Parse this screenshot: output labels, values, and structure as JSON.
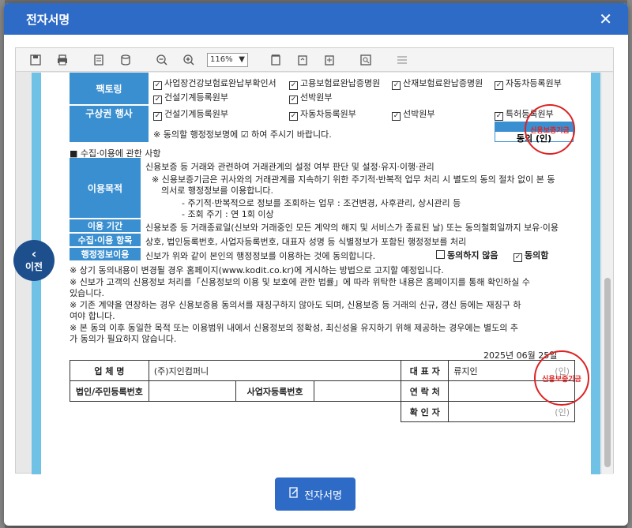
{
  "modal": {
    "title": "전자서명",
    "close_label": "✕"
  },
  "toolbar": {
    "zoom": "116%"
  },
  "form": {
    "factoring_label": "팩토링",
    "factoring_items": [
      "사업장건강보험료완납부확인서",
      "고용보험료완납증명원",
      "산재보험료완납증명원",
      "자동차등록원부",
      "건설기계등록원부",
      "선박원부"
    ],
    "recourse_label": "구상권 행사",
    "recourse_items": [
      "건설기계등록원부",
      "자동차등록원부",
      "선박원부",
      "특허등록원부"
    ],
    "consent_note": "※ 동의할 행정정보명에 ☑ 하여 주시기 바랍니다.",
    "consent_sign": "동의 (인)",
    "collection_header": "■ 수집·이용에 관한 사항",
    "purpose_label": "이용목적",
    "purpose_lines": [
      "신용보증 등 거래와 관련하여 거래관계의 설정 여부 판단 및 설정·유지·이행·관리",
      "※ 신용보증기금은 귀사와의 거래관계를 지속하기 위한 주기적·반복적 업무 처리 시 별도의 동의 절차 없이 본 동",
      "의서로 행정정보를 이용합니다.",
      "- 주기적·반복적으로 정보를 조회하는 업무 : 조건변경, 사후관리, 상시관리 등",
      "- 조회 주기 : 연 1회 이상"
    ],
    "period_label": "이용 기간",
    "period_text": "신용보증 등 거래종료일(신보와 거래중인 모든 계약의 해지 및 서비스가 종료된 날) 또는 동의철회일까지 보유·이용",
    "items_label": "수집·이용 항목",
    "items_text": "상호, 법인등록번호, 사업자등록번호, 대표자 성명 등 식별정보가 포함된 행정정보를 처리",
    "admin_label": "행정정보이용",
    "admin_text": "신보가 위와 같이 본인의 행정정보를 이용하는 것에 동의합니다.",
    "disagree_label": "동의하지 않음",
    "agree_label": "동의함",
    "notes": [
      "※ 상기 동의내용이 변경될 경우 홈페이지(www.kodit.co.kr)에 게시하는 방법으로 고지할 예정입니다.",
      "※ 신보가 고객의 신용정보 처리를「신용정보의 이용 및 보호에 관한 법률」에 따라 위탁한 내용은 홈페이지를 통해 확인하실 수",
      "   있습니다.",
      "※ 기존 계약을 연장하는 경우 신용보증용 동의서를 재징구하지 않아도 되며, 신용보증 등 거래의 신규, 갱신 등에는 재징구 하",
      "   여야 합니다.",
      "※ 본 동의 이후 동일한 목적 또는 이용범위 내에서 신용정보의 정확성, 최신성을 유지하기 위해 제공하는 경우에는 별도의 추",
      "   가 동의가 필요하지 않습니다."
    ],
    "date": "2025년   06월   25일",
    "company_label": "업 체 명",
    "company_value": "(주)지인컴퍼니",
    "rep_label": "대 표 자",
    "rep_value": "류지인",
    "seal_mark": "(인)",
    "corp_no_label": "법인/주민등록번호",
    "biz_no_label": "사업자등록번호",
    "contact_label": "연 락 처",
    "confirm_label": "확 인 자",
    "confirm_mark": "(인)",
    "stamp_text": "신용보증기금"
  },
  "nav": {
    "prev_label": "이전"
  },
  "footer": {
    "sign_button": "전자서명"
  }
}
